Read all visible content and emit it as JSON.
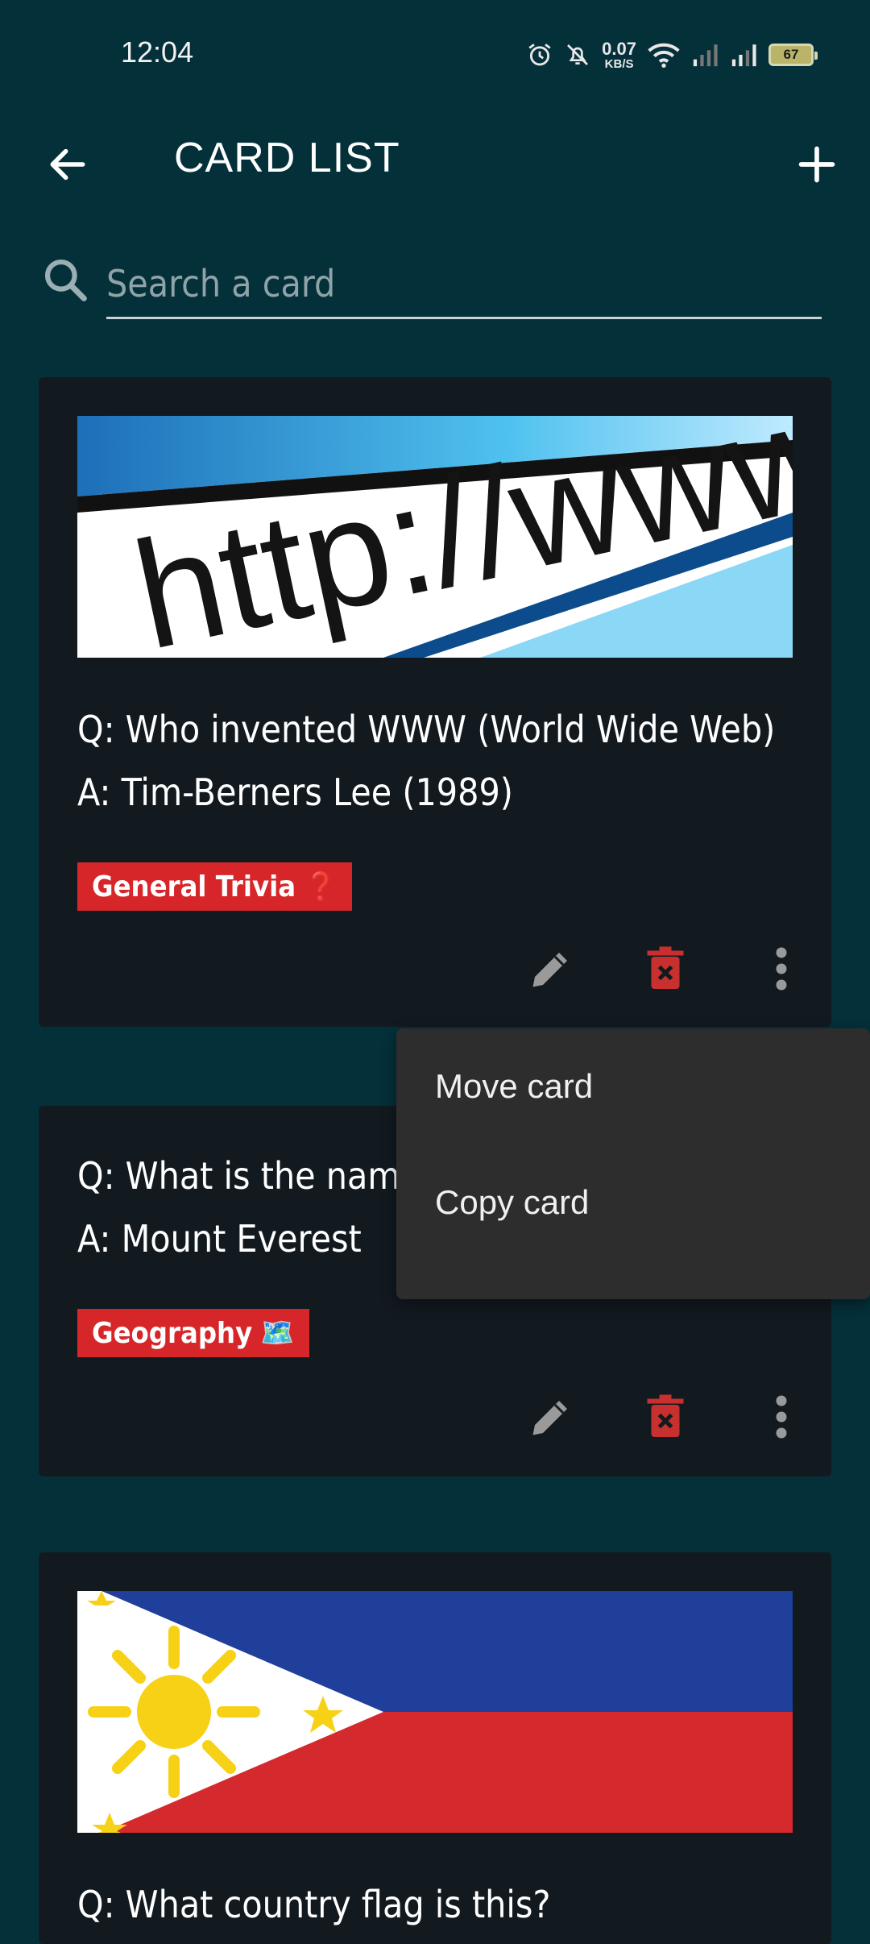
{
  "status": {
    "time": "12:04",
    "net_speed": "0.07",
    "net_unit": "KB/S",
    "battery": "67"
  },
  "header": {
    "title": "CARD LIST"
  },
  "search": {
    "placeholder": "Search a card"
  },
  "cards": [
    {
      "question": "Q: Who invented WWW (World Wide Web)",
      "answer": "A: Tim-Berners Lee (1989)",
      "tag": "General Trivia",
      "tag_emoji": "❓",
      "image": "http://www address bar"
    },
    {
      "question": "Q: What is the name of",
      "answer": "A: Mount Everest",
      "tag": "Geography",
      "tag_emoji": "🗺️"
    },
    {
      "question": "Q: What country flag is this?",
      "image": "philippines-flag"
    }
  ],
  "menu": {
    "items": [
      "Move card",
      "Copy card"
    ]
  },
  "colors": {
    "background": "#04303a",
    "card": "#121a20",
    "tag": "#d7262a",
    "delete": "#c7302f",
    "menu": "#2d2d2d"
  }
}
